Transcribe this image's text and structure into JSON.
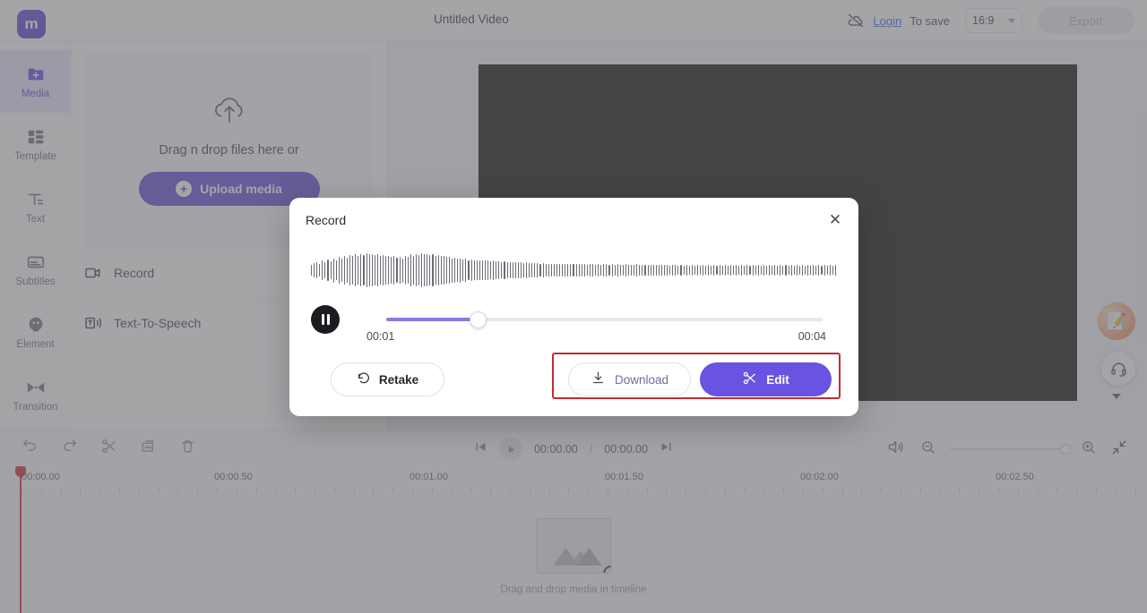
{
  "topbar": {
    "project_title": "Untitled Video",
    "cloud_icon": "cloud-off-icon",
    "login_label": "Login",
    "to_save_label": "To save",
    "aspect_ratio": "16:9",
    "export_label": "Export"
  },
  "sidebar": {
    "logo_glyph": "m",
    "items": [
      {
        "label": "Media",
        "icon": "media-folder-icon",
        "active": true
      },
      {
        "label": "Template",
        "icon": "template-grid-icon",
        "active": false
      },
      {
        "label": "Text",
        "icon": "text-t-icon",
        "active": false
      },
      {
        "label": "Subtitles",
        "icon": "subtitles-icon",
        "active": false
      },
      {
        "label": "Element",
        "icon": "element-icon",
        "active": false
      },
      {
        "label": "Transition",
        "icon": "transition-icon",
        "active": false
      }
    ]
  },
  "media_panel": {
    "drop_icon": "cloud-upload-icon",
    "drop_text": "Drag n drop files here or",
    "upload_label": "Upload media",
    "rows": [
      {
        "label": "Record",
        "icon": "record-camera-icon"
      },
      {
        "label": "Text-To-Speech",
        "icon": "text-to-speech-icon"
      }
    ]
  },
  "stage": {
    "assist_icon": "notepad-assistant-icon",
    "support_icon": "headset-icon"
  },
  "timeline": {
    "tools": [
      "undo-icon",
      "redo-icon",
      "split-scissors-icon",
      "crop-icon",
      "delete-trash-icon"
    ],
    "jump_start_icon": "skip-to-start-icon",
    "play_icon": "play-icon",
    "jump_end_icon": "skip-to-end-icon",
    "current_time": "00:00.00",
    "separator": "/",
    "total_time": "00:00.00",
    "volume_icon": "speaker-icon",
    "zoom_out_icon": "zoom-out-icon",
    "zoom_in_icon": "zoom-in-icon",
    "fit_icon": "fit-screen-icon",
    "ruler_labels": [
      "00:00.00",
      "00:00.50",
      "00:01.00",
      "00:01.50",
      "00:02.00",
      "00:02.50"
    ],
    "placeholder_text": "Drag and drop media in timeline",
    "placeholder_icon": "image-placeholder-icon"
  },
  "modal": {
    "title": "Record",
    "close_icon": "close-icon",
    "pause_icon": "pause-icon",
    "time_current": "00:01",
    "time_total": "00:04",
    "progress_percent": 21,
    "retake_label": "Retake",
    "retake_icon": "rotate-ccw-icon",
    "download_label": "Download",
    "download_icon": "download-arrow-icon",
    "edit_label": "Edit",
    "edit_icon": "scissors-icon",
    "waveform": [
      9,
      12,
      14,
      11,
      16,
      13,
      18,
      15,
      20,
      17,
      22,
      19,
      24,
      21,
      25,
      23,
      26,
      24,
      27,
      25,
      28,
      26,
      27,
      25,
      26,
      24,
      25,
      23,
      24,
      22,
      23,
      21,
      22,
      20,
      24,
      22,
      26,
      24,
      27,
      25,
      28,
      26,
      27,
      25,
      26,
      24,
      25,
      23,
      24,
      22,
      22,
      20,
      21,
      19,
      20,
      18,
      19,
      17,
      18,
      17,
      17,
      16,
      17,
      16,
      16,
      15,
      16,
      15,
      15,
      14,
      15,
      14,
      14,
      13,
      14,
      13,
      13,
      12,
      13,
      12,
      12,
      12,
      12,
      11,
      12,
      11,
      11,
      11,
      11,
      10,
      11,
      10,
      10,
      10,
      11,
      10,
      10,
      10,
      10,
      10,
      9,
      10,
      10,
      9,
      10,
      9,
      10,
      10,
      9,
      10,
      9,
      10,
      9,
      9,
      10,
      9,
      9,
      9,
      10,
      9,
      9,
      9,
      9,
      9,
      9,
      9,
      9,
      9,
      9,
      9,
      8,
      9,
      9,
      8,
      9,
      8,
      9,
      8,
      9,
      8,
      9,
      8,
      9,
      8,
      9,
      8,
      9,
      8,
      9,
      8,
      9,
      8,
      9,
      8,
      9,
      8,
      9,
      8,
      9,
      8,
      9,
      8,
      9,
      8,
      9,
      8,
      9,
      8,
      9,
      8,
      9,
      8,
      9,
      8,
      9,
      8,
      9,
      8,
      9,
      8,
      9,
      8,
      9,
      8,
      9,
      8,
      9,
      8,
      9,
      8,
      9
    ]
  },
  "colors": {
    "brand_purple": "#5b3fd6",
    "edit_purple": "#6a53e0",
    "highlight_red": "#c22b33",
    "playhead_red": "#d11a2a",
    "link_blue": "#2f62d8"
  }
}
